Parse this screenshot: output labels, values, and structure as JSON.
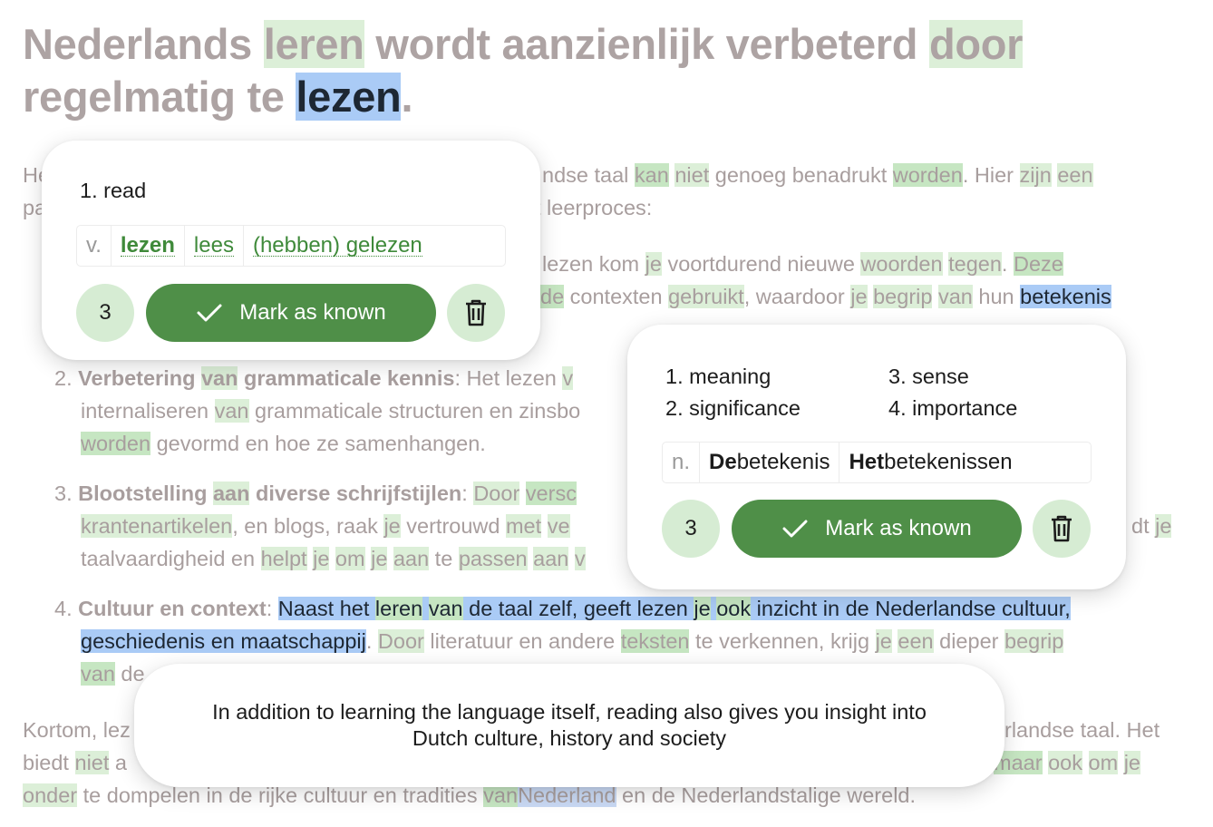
{
  "title": {
    "part1": "Nederlands ",
    "w1": "leren",
    "part2": " wordt aanzienlijk verbeterd ",
    "w2": "door",
    "part3": "regelmatig te ",
    "selected": "lezen",
    "part4": "."
  },
  "intro": {
    "line1_start": "He",
    "line1_mid": "ndse taal ",
    "kan": "kan",
    "niet": "niet",
    "genoeg": " genoeg benadrukt ",
    "worden": "worden",
    "hier": ". Hier ",
    "zijn": "zijn",
    "een": "een",
    "line2_start": "pa",
    "line2_end": "t leerproces:"
  },
  "item1": {
    "line1_start": "lezen kom ",
    "je": "je",
    "mid1": " voortdurend nieuwe ",
    "woorden": "woorden",
    "tegen": "tegen",
    "deze": "Deze",
    "line2_de": "de",
    "contexten": " contexten ",
    "gebruikt": "gebruikt",
    "waardoor": ", waardoor ",
    "je2": "je",
    "begrip": "begrip",
    "van": "van",
    "hun": " hun ",
    "betekenis": "betekenis"
  },
  "item2": {
    "num": "2.",
    "heading_a": "Verbetering ",
    "van": "van",
    "heading_b": " grammaticale kennis",
    "rest": ": Het lezen ",
    "v": "v",
    "line2_a": "internaliseren ",
    "van2": "van",
    "line2_b": " grammaticale structuren en zinsbo",
    "worden": "worden",
    "line3_rest": " gevormd en hoe ze samenhangen."
  },
  "item3": {
    "num": "3.",
    "heading_a": "Blootstelling ",
    "aan": "aan",
    "heading_b": " diverse schrijfstijlen",
    "door": "Door",
    "versc": "versc",
    "krant": "krantenartikelen",
    "blogs": ", en blogs, raak ",
    "je": "je",
    "vertrouwd": " vertrouwd ",
    "met": "met",
    "ve": "ve",
    "dt": "dt ",
    "je_end": "je",
    "line3_a": "taalvaardigheid en ",
    "helpt": "helpt",
    "je3": "je",
    "om": "om",
    "je4": "je",
    "aan2": "aan",
    "te": " te ",
    "passen": "passen",
    "aan3": "aan",
    "v": "v"
  },
  "item4": {
    "num": "4.",
    "heading": "Cultuur en context",
    "colon": ": ",
    "sel1": "Naast het ",
    "leren": "leren",
    "van": "van",
    "sel2": " de taal zelf, geeft lezen ",
    "je": "je",
    "ook": "ook",
    "sel3": " inzicht in de Nederlandse cultuur,",
    "sel4": "geschiedenis en maatschappij",
    "dot": ". ",
    "door": "Door",
    "lit": " literatuur en andere ",
    "teksten": "teksten",
    "verkennen": " te verkennen, krijg ",
    "je2": "je",
    "een": "een",
    "dieper": " dieper ",
    "begrip": "begrip",
    "van2": "van",
    "de": " de"
  },
  "outro": {
    "kortom": "Kortom, lez",
    "rlandse": "rlandse taal. Het",
    "biedt": "biedt ",
    "niet": "niet",
    "a": " a",
    "maar": "maar",
    "ook": "ook",
    "om": "om",
    "je": "je",
    "onder": "onder",
    "dompelen": " te dompelen in de rijke cultuur en tradities ",
    "van": "van",
    "nederland": "Nederland",
    "wereld": " en de Nederlandstalige wereld."
  },
  "card_lezen": {
    "definition": "1.  read",
    "pos": "v.",
    "forms": [
      "lezen",
      "lees",
      "(hebben) gelezen"
    ],
    "count": "3",
    "mark_label": "Mark as known"
  },
  "card_betekenis": {
    "definitions": [
      "1.  meaning",
      "2.  significance",
      "3.  sense",
      "4.  importance"
    ],
    "pos": "n.",
    "form1_article": "De",
    "form1_word": " betekenis",
    "form2_article": "Het",
    "form2_word": " betekenissen",
    "count": "3",
    "mark_label": "Mark as known"
  },
  "translation": {
    "line1": "In addition to learning the language itself, reading also gives you insight into",
    "line2": "Dutch culture, history and society"
  },
  "colors": {
    "known_highlight": "#dcefd8",
    "selected_highlight": "#aacbf6",
    "button_green": "#4f8f48",
    "count_bg": "#d6ecd3"
  },
  "icons": [
    "check-icon",
    "trash-icon"
  ]
}
